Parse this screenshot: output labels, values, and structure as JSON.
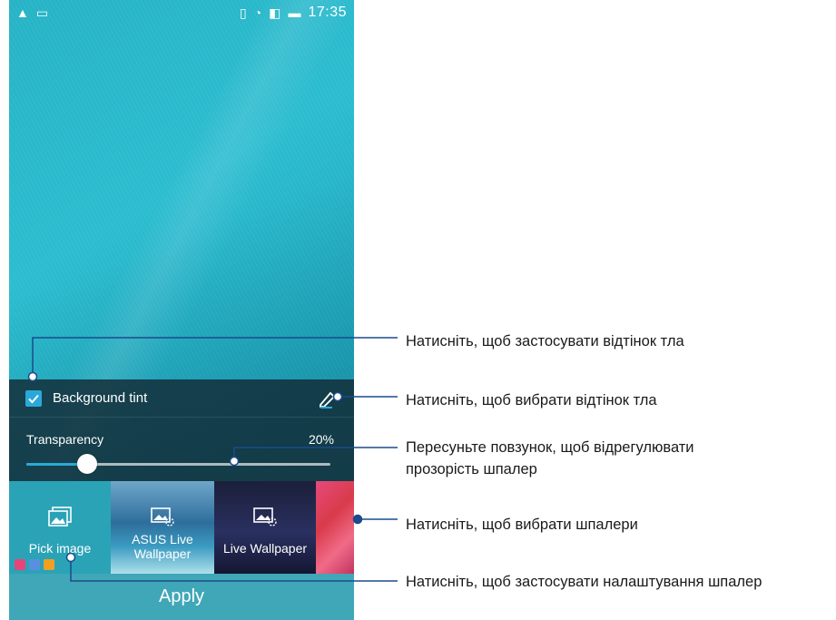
{
  "status_bar": {
    "left_icons": [
      "asus-icon",
      "image-icon"
    ],
    "right_icons": [
      "vibrate-icon",
      "wifi-icon",
      "sim-icon",
      "battery-icon"
    ],
    "time": "17:35"
  },
  "panel": {
    "background_tint_label": "Background tint",
    "background_tint_checked": true,
    "transparency_label": "Transparency",
    "transparency_value": "20%",
    "transparency_fraction": 0.2
  },
  "wallpapers": {
    "pick_label": "Pick image",
    "asus_label_line1": "ASUS Live",
    "asus_label_line2": "Wallpaper",
    "live_label": "Live Wallpaper"
  },
  "apply_label": "Apply",
  "callouts": {
    "c1": "Натисніть, щоб застосувати відтінок тла",
    "c2": "Натисніть, щоб вибрати відтінок тла",
    "c3_line1": "Пересуньте повзунок, щоб відрегулювати",
    "c3_line2": "прозорість шпалер",
    "c4": "Натисніть, щоб вибрати шпалери",
    "c5": "Натисніть, щоб застосувати налаштування шпалер"
  },
  "colors": {
    "accent": "#2aa9d8",
    "callout_line": "#1a4b8c"
  }
}
